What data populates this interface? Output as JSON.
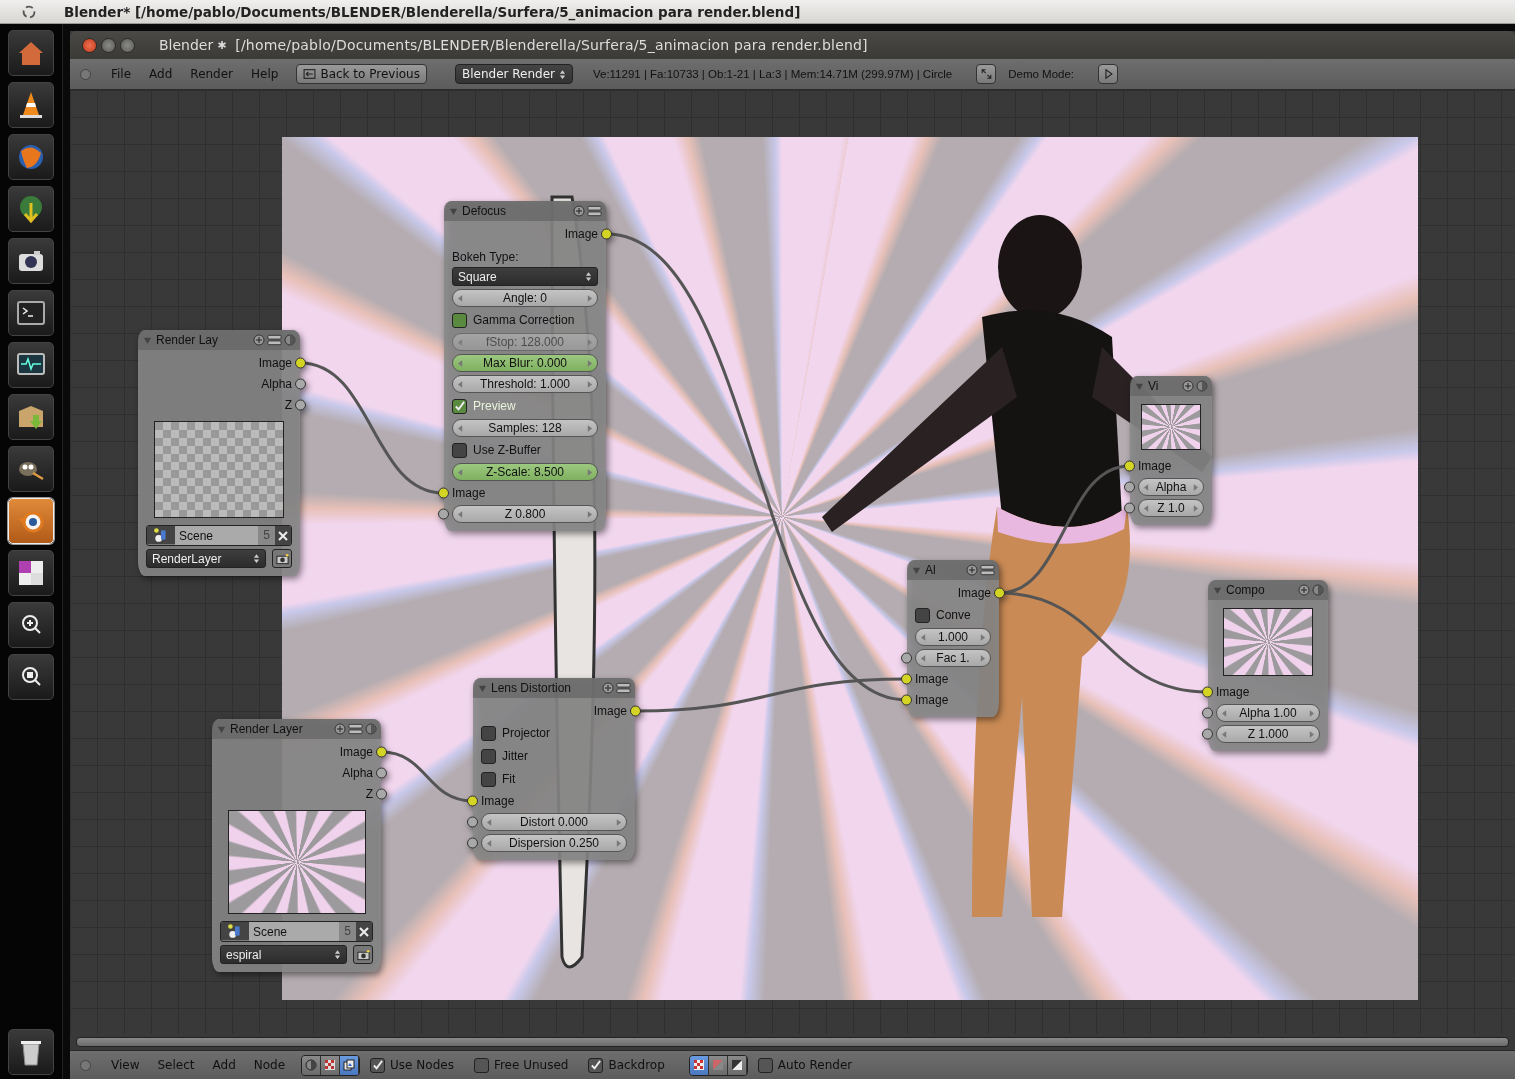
{
  "os_title": "Blender* [/home/pablo/Documents/BLENDER/Blenderella/Surfera/5_animacion para render.blend]",
  "launcher": [
    {
      "kind": "home",
      "active": false
    },
    {
      "kind": "cone",
      "active": false
    },
    {
      "kind": "globe",
      "active": false
    },
    {
      "kind": "maps",
      "active": false
    },
    {
      "kind": "camera",
      "active": false
    },
    {
      "kind": "terminal",
      "active": false
    },
    {
      "kind": "monitor",
      "active": false
    },
    {
      "kind": "package",
      "active": false
    },
    {
      "kind": "mascot",
      "active": false
    },
    {
      "kind": "blender",
      "active": true
    },
    {
      "kind": "workspaces",
      "active": false
    },
    {
      "kind": "zoom",
      "active": false
    },
    {
      "kind": "finder",
      "active": false
    }
  ],
  "window": {
    "title": "Blender",
    "path": "[/home/pablo/Documents/BLENDER/Blenderella/Surfera/5_animacion para render.blend]"
  },
  "header": {
    "menus": [
      "File",
      "Add",
      "Render",
      "Help"
    ],
    "back_button": "Back to Previous",
    "engine": "Blender Render",
    "stats": "Ve:11291 | Fa:10733 | Ob:1-21 | La:3 | Mem:14.71M (299.97M) | Circle",
    "demo_label": "Demo Mode:"
  },
  "nodes": [
    {
      "title": "Render Lay",
      "rows": [
        {
          "kind": "output",
          "label": "Image",
          "color": "#d4d424"
        },
        {
          "kind": "output",
          "label": "Alpha",
          "color": "#a8a8a8"
        },
        {
          "kind": "output",
          "label": "Z",
          "color": "#a8a8a8"
        },
        {
          "kind": "preview"
        },
        {
          "kind": "scene",
          "name": "Scene",
          "count": "5"
        },
        {
          "kind": "layer",
          "value": "RenderLayer"
        }
      ]
    },
    {
      "title": "Defocus",
      "rows": [
        {
          "kind": "output",
          "label": "Image",
          "color": "#d4d424"
        },
        {
          "kind": "label",
          "label": "Bokeh Type:"
        },
        {
          "kind": "dropdown",
          "value": "Square"
        },
        {
          "kind": "field",
          "value": "Angle: 0",
          "highlighted": false,
          "disabled": false
        },
        {
          "kind": "checkbox",
          "label": "Gamma Correction",
          "checked": false,
          "highlighted": true
        },
        {
          "kind": "field",
          "value": "fStop: 128.000",
          "highlighted": false,
          "disabled": true
        },
        {
          "kind": "field",
          "value": "Max Blur: 0.000",
          "highlighted": true,
          "disabled": false
        },
        {
          "kind": "field",
          "value": "Threshold: 1.000",
          "highlighted": false,
          "disabled": false
        },
        {
          "kind": "checkbox",
          "label": "Preview",
          "checked": true,
          "highlighted": true
        },
        {
          "kind": "field",
          "value": "Samples: 128",
          "highlighted": false,
          "disabled": false
        },
        {
          "kind": "checkbox",
          "label": "Use Z-Buffer",
          "checked": false,
          "highlighted": false
        },
        {
          "kind": "field",
          "value": "Z-Scale: 8.500",
          "highlighted": true,
          "disabled": false
        },
        {
          "kind": "input",
          "label": "Image",
          "color": "#d4d424"
        },
        {
          "kind": "field",
          "value": "Z 0.800",
          "color": "#a8a8a8",
          "highlighted": false,
          "disabled": false
        }
      ]
    },
    {
      "title": "Render Layer",
      "rows": [
        {
          "kind": "output",
          "label": "Image",
          "color": "#d4d424"
        },
        {
          "kind": "output",
          "label": "Alpha",
          "color": "#a8a8a8"
        },
        {
          "kind": "output",
          "label": "Z",
          "color": "#a8a8a8"
        },
        {
          "kind": "preview"
        },
        {
          "kind": "scene",
          "name": "Scene",
          "count": "5"
        },
        {
          "kind": "layer",
          "value": "espiral"
        }
      ]
    },
    {
      "title": "Lens Distortion",
      "rows": [
        {
          "kind": "output",
          "label": "Image",
          "color": "#d4d424"
        },
        {
          "kind": "checkbox",
          "label": "Projector",
          "checked": false,
          "highlighted": false
        },
        {
          "kind": "checkbox",
          "label": "Jitter",
          "checked": false,
          "highlighted": false
        },
        {
          "kind": "checkbox",
          "label": "Fit",
          "checked": false,
          "highlighted": false
        },
        {
          "kind": "input",
          "label": "Image",
          "color": "#d4d424"
        },
        {
          "kind": "field",
          "value": "Distort 0.000",
          "color": "#a8a8a8",
          "highlighted": false,
          "disabled": false
        },
        {
          "kind": "field",
          "value": "Dispersion 0.250",
          "color": "#a8a8a8",
          "highlighted": false,
          "disabled": false
        }
      ]
    },
    {
      "title": "Al",
      "rows": [
        {
          "kind": "output",
          "label": "Image",
          "color": "#d4d424"
        },
        {
          "kind": "checkbox",
          "label": "Conve",
          "checked": false,
          "highlighted": false
        },
        {
          "kind": "field",
          "value": "1.000",
          "highlighted": false,
          "disabled": false
        },
        {
          "kind": "field",
          "value": "Fac 1.",
          "color": "#a8a8a8",
          "highlighted": false,
          "disabled": false
        },
        {
          "kind": "input",
          "label": "Image",
          "color": "#d4d424"
        },
        {
          "kind": "input",
          "label": "Image",
          "color": "#d4d424"
        }
      ]
    },
    {
      "title": "Vi",
      "rows": [
        {
          "kind": "preview"
        },
        {
          "kind": "input",
          "label": "Image",
          "color": "#d4d424"
        },
        {
          "kind": "field",
          "value": "Alpha",
          "color": "#a8a8a8",
          "highlighted": false,
          "disabled": false
        },
        {
          "kind": "field",
          "value": "Z 1.0",
          "color": "#a8a8a8",
          "highlighted": false,
          "disabled": false
        }
      ]
    },
    {
      "title": "Compo",
      "rows": [
        {
          "kind": "preview"
        },
        {
          "kind": "input",
          "label": "Image",
          "color": "#d4d424"
        },
        {
          "kind": "field",
          "value": "Alpha 1.00",
          "color": "#a8a8a8",
          "highlighted": false,
          "disabled": false
        },
        {
          "kind": "field",
          "value": "Z 1.000",
          "color": "#a8a8a8",
          "highlighted": false,
          "disabled": false
        }
      ]
    }
  ],
  "footer": {
    "menus": [
      "View",
      "Select",
      "Add",
      "Node"
    ],
    "tree_types": [
      {
        "kind": "shader",
        "selected": false
      },
      {
        "kind": "texture",
        "selected": false
      },
      {
        "kind": "compositing",
        "selected": true
      }
    ],
    "toggles": [
      {
        "label": "Use Nodes",
        "checked": true
      },
      {
        "label": "Free Unused",
        "checked": false
      },
      {
        "label": "Backdrop",
        "checked": true
      }
    ],
    "channels": [
      {
        "kind": "color",
        "selected": true
      },
      {
        "kind": "color_alpha",
        "selected": false
      },
      {
        "kind": "alpha",
        "selected": false
      }
    ],
    "auto_render": {
      "label": "Auto Render",
      "checked": false
    }
  }
}
